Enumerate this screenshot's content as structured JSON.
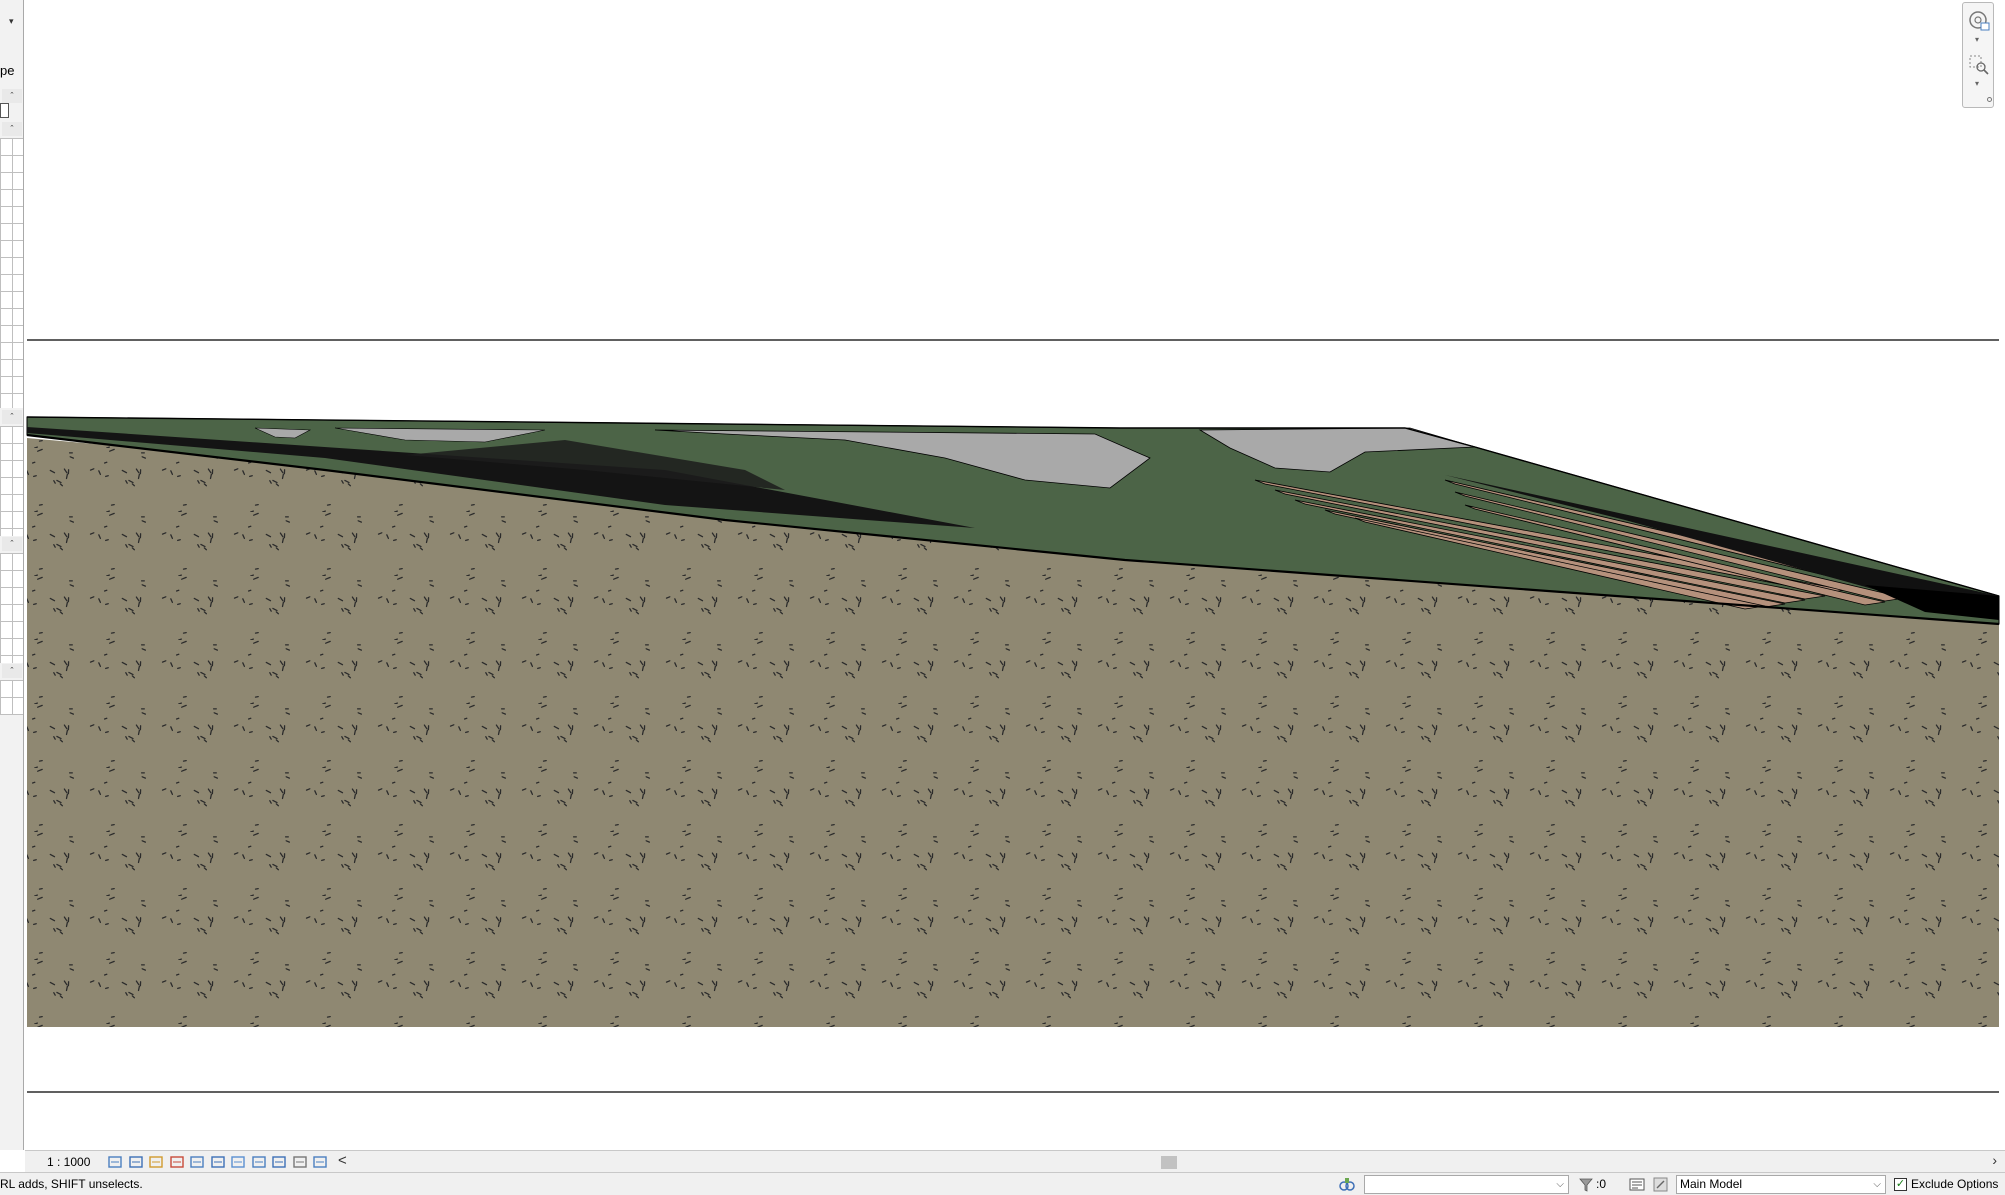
{
  "left_panel": {
    "type_label_fragment": "pe",
    "dropdown_glyph": "▾",
    "collapse_glyph": "ˆ"
  },
  "canvas": {
    "colors": {
      "background": "#ffffff",
      "earth": "#8f8872",
      "earth_speckle": "#2b2b2b",
      "grass": "#4c6447",
      "paving": "#a9a9a9",
      "clay_stripe": "#b5917c",
      "outline": "#000000"
    }
  },
  "nav_bar": {
    "icons": [
      "steering-wheel-icon",
      "zoom-region-icon"
    ],
    "caret": "▾"
  },
  "view_bar": {
    "scale": "1 : 1000",
    "icons": [
      "detail-level-icon",
      "visual-style-icon",
      "sun-path-icon",
      "shadows-icon",
      "crop-view-icon",
      "show-crop-icon",
      "temporary-hide-icon",
      "reveal-hidden-icon",
      "lock-view-icon",
      "analysis-display-icon",
      "highlight-displacement-icon"
    ],
    "chevron": "<",
    "scroll_right": "›"
  },
  "status_bar": {
    "message": "RL adds, SHIFT unselects.",
    "selection_count": ":0",
    "design_option": "",
    "model_option": "Main Model",
    "exclude_options_label": "Exclude Options",
    "exclude_options_checked": true,
    "check_glyph": "✓",
    "combo_arrow": "⌵"
  }
}
